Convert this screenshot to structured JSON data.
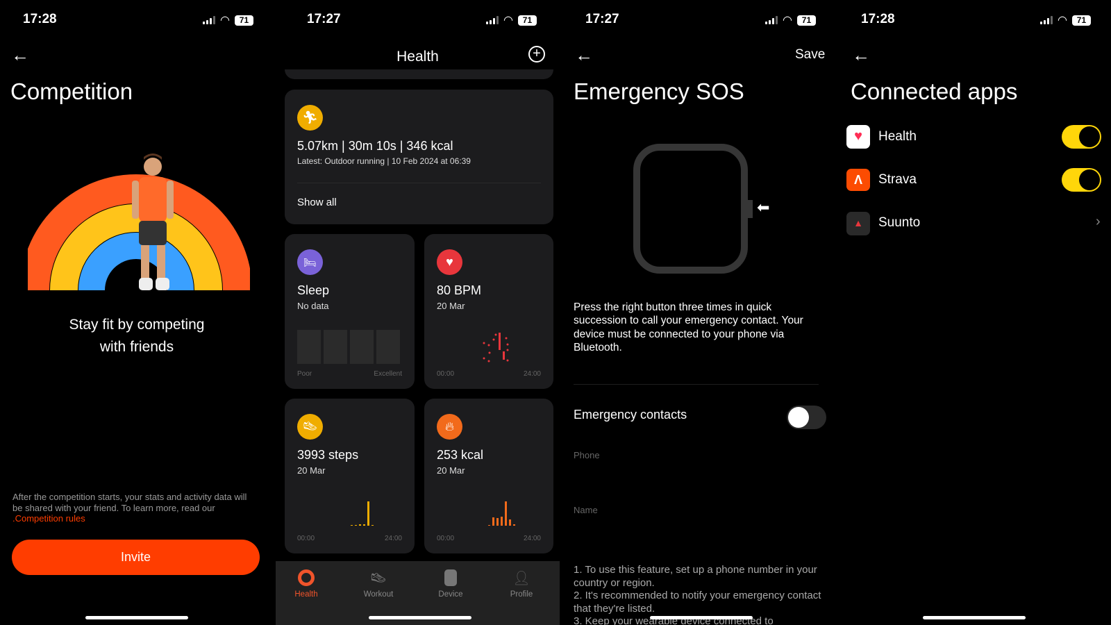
{
  "status": {
    "time1": "17:28",
    "time2": "17:27",
    "time3": "17:27",
    "time4": "17:28",
    "battery": "71"
  },
  "competition": {
    "title": "Competition",
    "tagline_line1": "Stay fit by competing",
    "tagline_line2": "with friends",
    "disclaimer": "After the competition starts, your stats and activity data will be shared with your friend. To learn more, read our ",
    "rules_link": ".Competition rules",
    "invite_label": "Invite",
    "accent": "#ff3d00"
  },
  "health": {
    "title": "Health",
    "workout": {
      "summary": "5.07km | 30m 10s | 346 kcal",
      "latest": "Latest: Outdoor running | 10 Feb 2024 at 06:39",
      "show_all": "Show all"
    },
    "sleep": {
      "title": "Sleep",
      "sub": "No data",
      "poor": "Poor",
      "excellent": "Excellent"
    },
    "heart": {
      "title": "80 BPM",
      "sub": "20 Mar",
      "start": "00:00",
      "end": "24:00"
    },
    "steps": {
      "title": "3993 steps",
      "sub": "20 Mar",
      "start": "00:00",
      "end": "24:00",
      "bars": [
        0.03,
        0,
        0.05,
        0.05,
        1,
        0.02
      ]
    },
    "calories": {
      "title": "253 kcal",
      "sub": "20 Mar",
      "start": "00:00",
      "end": "24:00",
      "bars": [
        0.02,
        0.35,
        0.32,
        0.36,
        1,
        0.25,
        0.07
      ]
    },
    "nav": [
      {
        "label": "Health",
        "active": true
      },
      {
        "label": "Workout"
      },
      {
        "label": "Device"
      },
      {
        "label": "Profile"
      }
    ]
  },
  "sos": {
    "title": "Emergency SOS",
    "save": "Save",
    "description": "Press the right button three times in quick succession to call your emergency contact. Your device must be connected to your phone via Bluetooth.",
    "contacts_label": "Emergency contacts",
    "contacts_enabled": false,
    "phone_label": "Phone",
    "name_label": "Name",
    "notes": [
      "1. To use this feature, set up a phone number in your country or region.",
      "2. It's recommended to notify your emergency contact that they're listed.",
      "3. Keep your wearable device connected to"
    ]
  },
  "connected": {
    "title": "Connected apps",
    "apps": [
      {
        "name": "Health",
        "enabled": true
      },
      {
        "name": "Strava",
        "enabled": true
      },
      {
        "name": "Suunto"
      }
    ],
    "toggle_color": "#ffd60a"
  }
}
